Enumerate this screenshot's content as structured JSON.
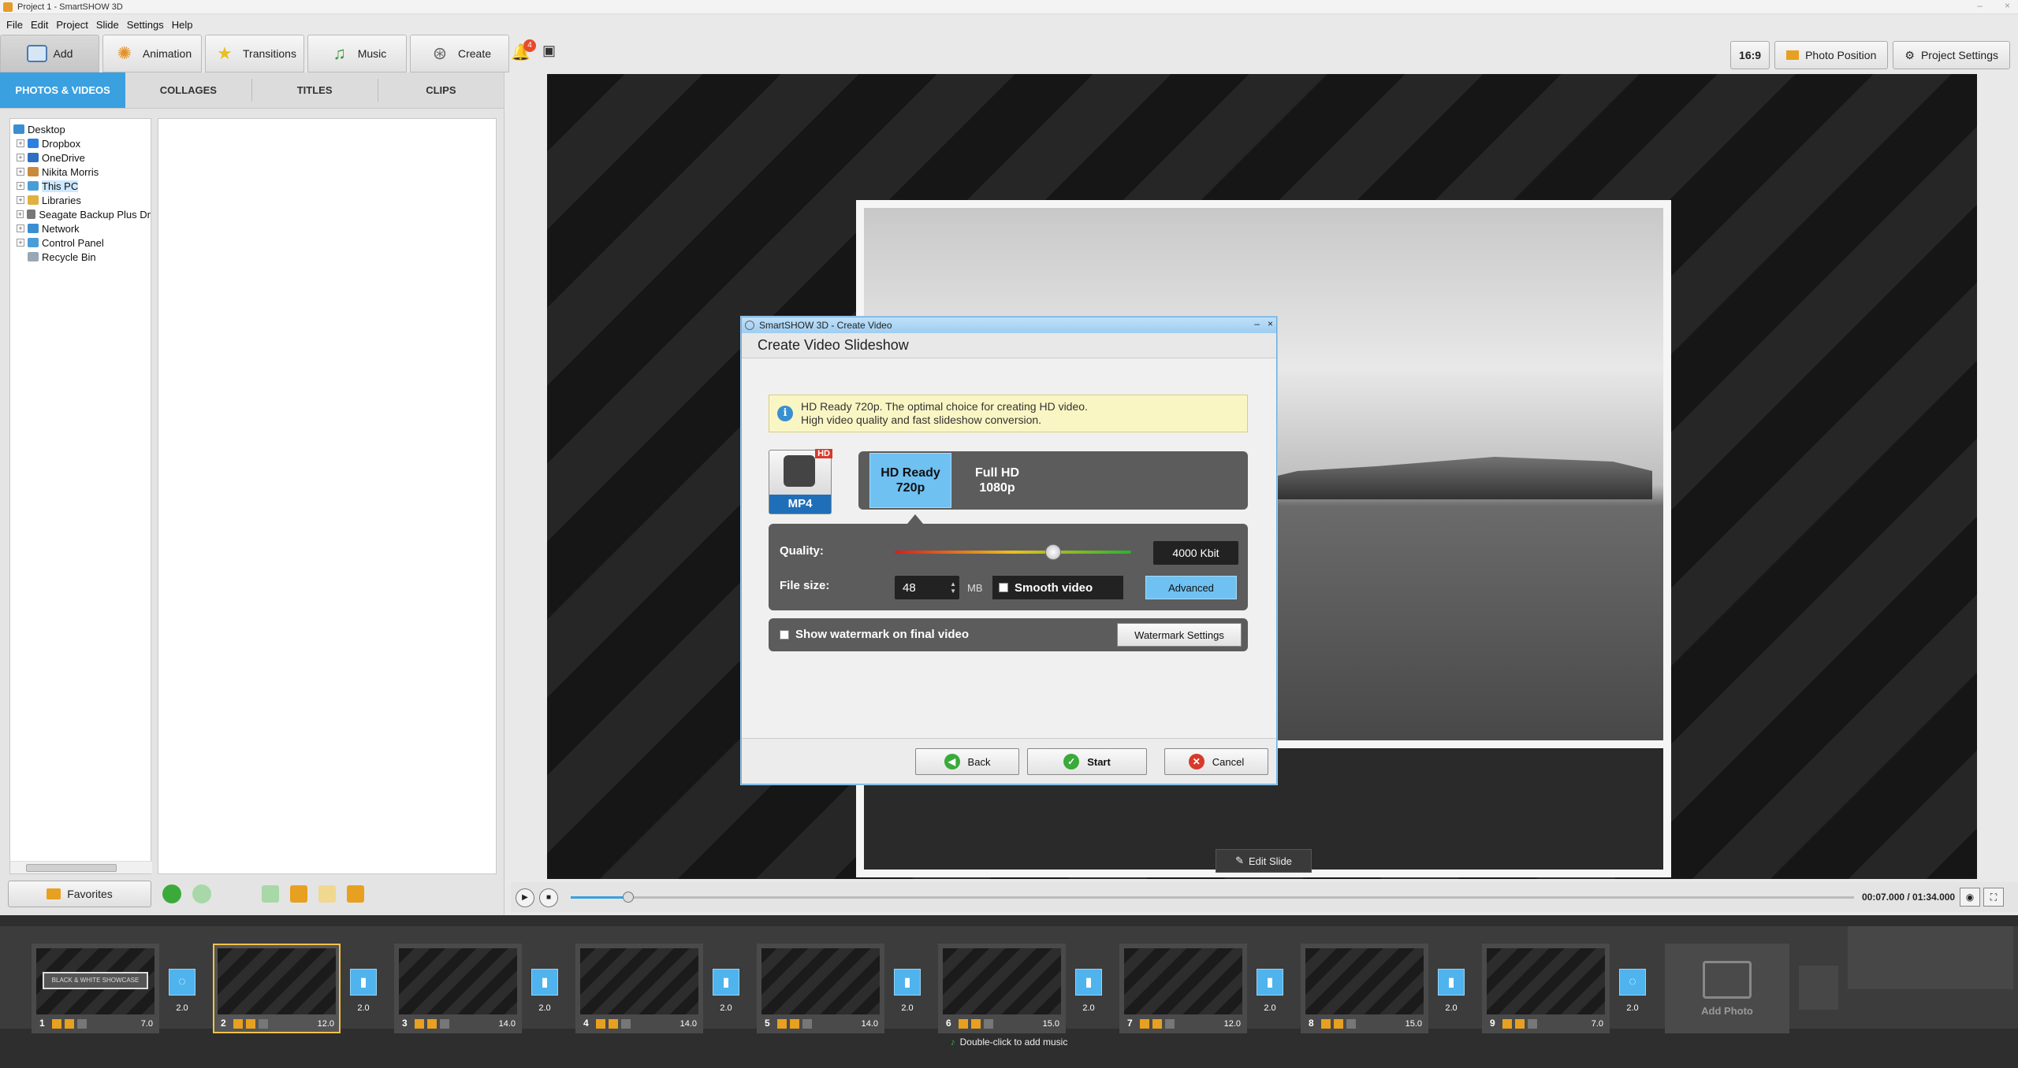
{
  "window": {
    "title": "Project 1 - SmartSHOW 3D",
    "min": "–",
    "close": "×"
  },
  "menu": [
    "File",
    "Edit",
    "Project",
    "Slide",
    "Settings",
    "Help"
  ],
  "tooltabs": [
    {
      "label": "Add",
      "icon": "add-photo-icon",
      "active": true
    },
    {
      "label": "Animation",
      "icon": "palette-icon"
    },
    {
      "label": "Transitions",
      "icon": "star-icon"
    },
    {
      "label": "Music",
      "icon": "music-note-icon"
    },
    {
      "label": "Create",
      "icon": "film-reel-icon"
    }
  ],
  "notifications": {
    "count": "4"
  },
  "right_toolbar": {
    "aspect": "16:9",
    "photo_position": "Photo Position",
    "project_settings": "Project Settings"
  },
  "subtabs": [
    "PHOTOS & VIDEOS",
    "COLLAGES",
    "TITLES",
    "CLIPS"
  ],
  "tree": [
    {
      "label": "Desktop",
      "root": true,
      "color": "#3a8fd0"
    },
    {
      "label": "Dropbox",
      "color": "#2d7fe0"
    },
    {
      "label": "OneDrive",
      "color": "#2d6fc0"
    },
    {
      "label": "Nikita Morris",
      "color": "#c98a3a"
    },
    {
      "label": "This PC",
      "color": "#4a9ed8",
      "selected": true
    },
    {
      "label": "Libraries",
      "color": "#e0b040"
    },
    {
      "label": "Seagate Backup Plus Dr",
      "color": "#777777"
    },
    {
      "label": "Network",
      "color": "#3a8fd0"
    },
    {
      "label": "Control Panel",
      "color": "#4a9ed8"
    },
    {
      "label": "Recycle Bin",
      "color": "#9aa7b4",
      "noexp": true
    }
  ],
  "favorites_label": "Favorites",
  "preview": {
    "edit_slide": "Edit Slide"
  },
  "player": {
    "time": "00:07.000 / 01:34.000",
    "progress": 0.045
  },
  "slides": [
    {
      "num": "1",
      "dur": "7.0",
      "trans": "2.0"
    },
    {
      "num": "2",
      "dur": "12.0",
      "trans": "2.0",
      "selected": true
    },
    {
      "num": "3",
      "dur": "14.0",
      "trans": "2.0"
    },
    {
      "num": "4",
      "dur": "14.0",
      "trans": "2.0"
    },
    {
      "num": "5",
      "dur": "14.0",
      "trans": "2.0"
    },
    {
      "num": "6",
      "dur": "15.0",
      "trans": "2.0"
    },
    {
      "num": "7",
      "dur": "12.0",
      "trans": "2.0"
    },
    {
      "num": "8",
      "dur": "15.0",
      "trans": "2.0"
    },
    {
      "num": "9",
      "dur": "7.0",
      "trans": "2.0"
    }
  ],
  "slide1_caption": "BLACK & WHITE SHOWCASE",
  "add_photo": "Add Photo",
  "music_hint": "Double-click to add music",
  "dialog": {
    "window_title": "SmartSHOW 3D - Create Video",
    "heading": "Create Video Slideshow",
    "info_line1": "HD Ready 720p. The optimal choice for creating HD video.",
    "info_line2": "High video quality and fast slideshow conversion.",
    "format": "MP4",
    "format_badge": "HD",
    "res_options": [
      {
        "line1": "HD Ready",
        "line2": "720p",
        "selected": true
      },
      {
        "line1": "Full HD",
        "line2": "1080p"
      }
    ],
    "quality_label": "Quality:",
    "quality_value": "4000 Kbit",
    "quality_level": 0.67,
    "filesize_label": "File size:",
    "filesize_value": "48",
    "filesize_unit": "MB",
    "smooth_label": "Smooth video",
    "advanced": "Advanced",
    "watermark_label": "Show watermark on final video",
    "watermark_settings": "Watermark Settings",
    "back": "Back",
    "start": "Start",
    "cancel": "Cancel"
  }
}
